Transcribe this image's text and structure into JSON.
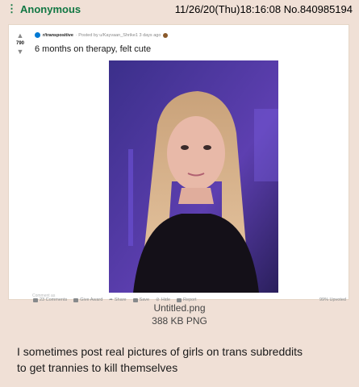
{
  "post": {
    "dots": "⋮",
    "name": "Anonymous",
    "datetime": "11/26/20(Thu)18:16:08",
    "post_number": "No.840985194"
  },
  "reddit": {
    "subreddit": "r/transpositive",
    "posted_by": "· Posted by u/Kayvaan_Shrike1 3 days ago",
    "vote_count": "790",
    "title": "6 months on therapy, felt cute",
    "actions": {
      "comments": "23 Comments",
      "give_award": "Give Award",
      "share": "Share",
      "save": "Save",
      "hide": "Hide",
      "report": "Report",
      "upvoted": "99% Upvoted"
    },
    "comment_as": "Comment as"
  },
  "file": {
    "name": "Untitled.png",
    "size": "388 KB PNG"
  },
  "message": {
    "line1": "I sometimes post real pictures of girls on trans subreddits",
    "line2": "to get trannies to kill themselves"
  },
  "colors": {
    "background": "#f0e0d6",
    "name_green": "#117743",
    "photo_bg": "#4a3a8f"
  }
}
